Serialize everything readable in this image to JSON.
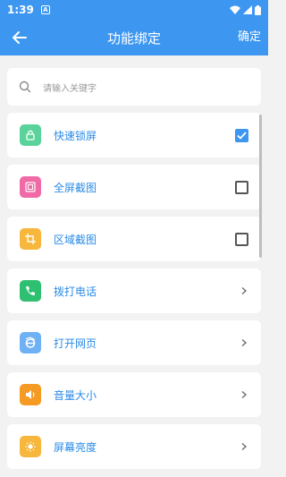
{
  "status": {
    "time": "1:39",
    "badge": "A"
  },
  "header": {
    "title": "功能绑定",
    "confirm_label": "确定"
  },
  "search": {
    "placeholder": "请输入关键字"
  },
  "items": [
    {
      "label": "快速锁屏",
      "icon": "lock-icon",
      "color": "#5ad39a",
      "trail": "checkbox",
      "checked": true
    },
    {
      "label": "全屏截图",
      "icon": "fullscreen-screenshot-icon",
      "color": "#f06aa5",
      "trail": "checkbox",
      "checked": false
    },
    {
      "label": "区域截图",
      "icon": "crop-icon",
      "color": "#f6b73c",
      "trail": "checkbox",
      "checked": false
    },
    {
      "label": "拨打电话",
      "icon": "phone-icon",
      "color": "#2fbf71",
      "trail": "chevron"
    },
    {
      "label": "打开网页",
      "icon": "browser-icon",
      "color": "#6fb1f5",
      "trail": "chevron"
    },
    {
      "label": "音量大小",
      "icon": "volume-icon",
      "color": "#f59a23",
      "trail": "chevron"
    },
    {
      "label": "屏幕亮度",
      "icon": "brightness-icon",
      "color": "#f6b73c",
      "trail": "chevron"
    }
  ],
  "colors": {
    "primary": "#3d97f0",
    "label": "#2a8be6",
    "background": "#f2f2f2"
  }
}
